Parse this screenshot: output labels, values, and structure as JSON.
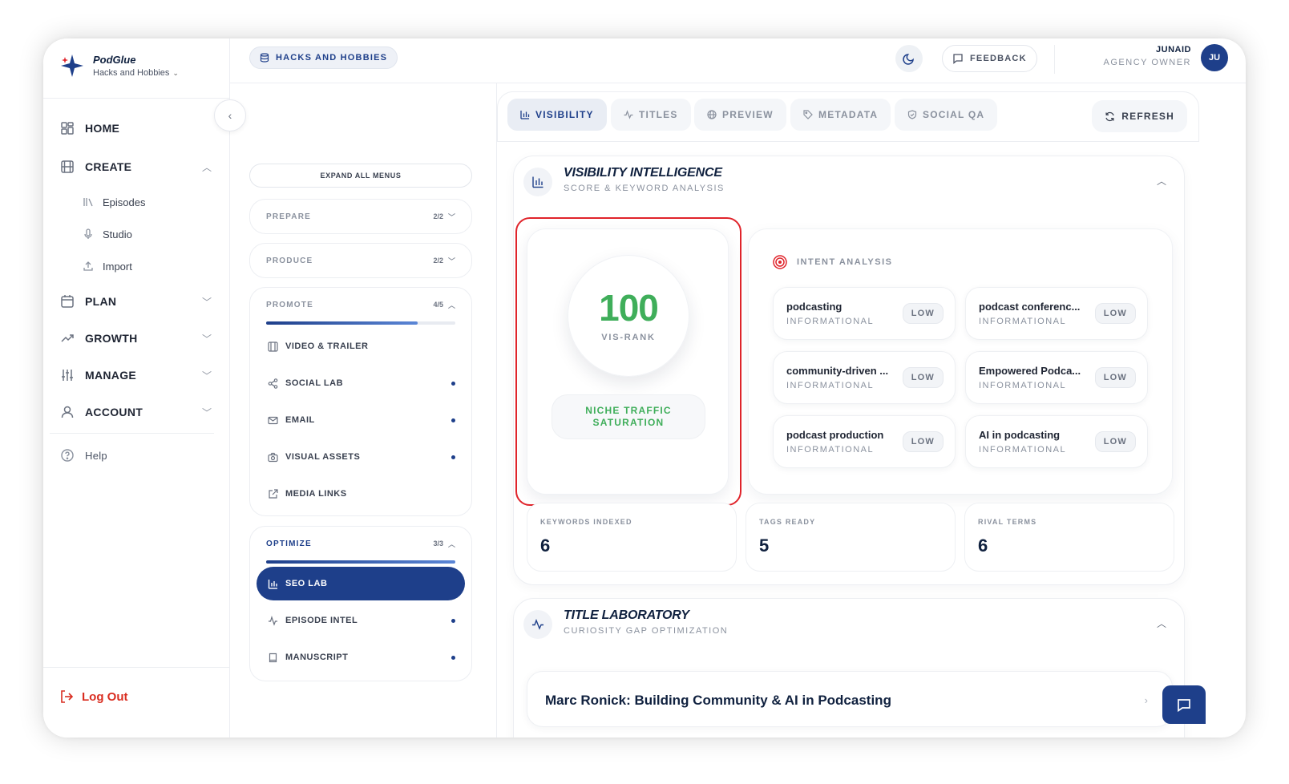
{
  "app": {
    "name": "PodGlue",
    "workspace": "Hacks and Hobbies",
    "brand_color": "#1e3f8a",
    "accent_green": "#3fae5a",
    "highlight_red": "#e0242b"
  },
  "sidebar": {
    "nav": [
      {
        "label": "HOME",
        "icon": "grid-icon"
      },
      {
        "label": "CREATE",
        "icon": "film-icon",
        "expanded": true
      },
      {
        "label": "PLAN",
        "icon": "calendar-icon"
      },
      {
        "label": "GROWTH",
        "icon": "trend-up-icon"
      },
      {
        "label": "MANAGE",
        "icon": "sliders-icon"
      },
      {
        "label": "ACCOUNT",
        "icon": "user-icon"
      }
    ],
    "create_sub": [
      {
        "label": "Episodes",
        "icon": "library-icon"
      },
      {
        "label": "Studio",
        "icon": "microphone-icon"
      },
      {
        "label": "Import",
        "icon": "upload-icon"
      }
    ],
    "help": "Help",
    "logout": "Log Out"
  },
  "topbar": {
    "project": "HACKS AND HOBBIES",
    "feedback": "FEEDBACK",
    "user_name": "JUNAID",
    "user_role": "AGENCY OWNER",
    "avatar_initials": "JU"
  },
  "menu": {
    "expand_all": "EXPAND ALL MENUS",
    "prepare": {
      "title": "PREPARE",
      "count": "2/2"
    },
    "produce": {
      "title": "PRODUCE",
      "count": "2/2"
    },
    "promote": {
      "title": "PROMOTE",
      "count": "4/5",
      "progress": 0.8,
      "items": [
        {
          "label": "VIDEO & TRAILER",
          "dot": false
        },
        {
          "label": "SOCIAL LAB",
          "dot": true
        },
        {
          "label": "EMAIL",
          "dot": true
        },
        {
          "label": "VISUAL ASSETS",
          "dot": true
        },
        {
          "label": "MEDIA LINKS",
          "dot": false
        }
      ]
    },
    "optimize": {
      "title": "OPTIMIZE",
      "count": "3/3",
      "progress": 1.0,
      "items": [
        {
          "label": "SEO LAB",
          "active": true
        },
        {
          "label": "EPISODE INTEL",
          "dot": true
        },
        {
          "label": "MANUSCRIPT",
          "dot": true
        }
      ]
    }
  },
  "tabs": [
    {
      "label": "VISIBILITY",
      "active": true
    },
    {
      "label": "TITLES"
    },
    {
      "label": "PREVIEW"
    },
    {
      "label": "METADATA"
    },
    {
      "label": "SOCIAL QA"
    }
  ],
  "refresh": "REFRESH",
  "visibility": {
    "title": "VISIBILITY INTELLIGENCE",
    "subtitle": "SCORE & KEYWORD ANALYSIS",
    "score": "100",
    "score_label": "VIS-RANK",
    "score_badge": "NICHE TRAFFIC SATURATION",
    "intent_title": "INTENT ANALYSIS",
    "keywords": [
      {
        "name": "podcasting",
        "type": "INFORMATIONAL",
        "level": "LOW"
      },
      {
        "name": "podcast conferenc...",
        "type": "INFORMATIONAL",
        "level": "LOW"
      },
      {
        "name": "community-driven ...",
        "type": "INFORMATIONAL",
        "level": "LOW"
      },
      {
        "name": "Empowered Podca...",
        "type": "INFORMATIONAL",
        "level": "LOW"
      },
      {
        "name": "podcast production",
        "type": "INFORMATIONAL",
        "level": "LOW"
      },
      {
        "name": "AI in podcasting",
        "type": "INFORMATIONAL",
        "level": "LOW"
      }
    ],
    "stats": [
      {
        "label": "KEYWORDS INDEXED",
        "value": "6"
      },
      {
        "label": "TAGS READY",
        "value": "5"
      },
      {
        "label": "RIVAL TERMS",
        "value": "6"
      }
    ]
  },
  "title_lab": {
    "title": "TITLE LABORATORY",
    "subtitle": "CURIOSITY GAP OPTIMIZATION",
    "first_title": "Marc Ronick: Building Community & AI in Podcasting"
  }
}
